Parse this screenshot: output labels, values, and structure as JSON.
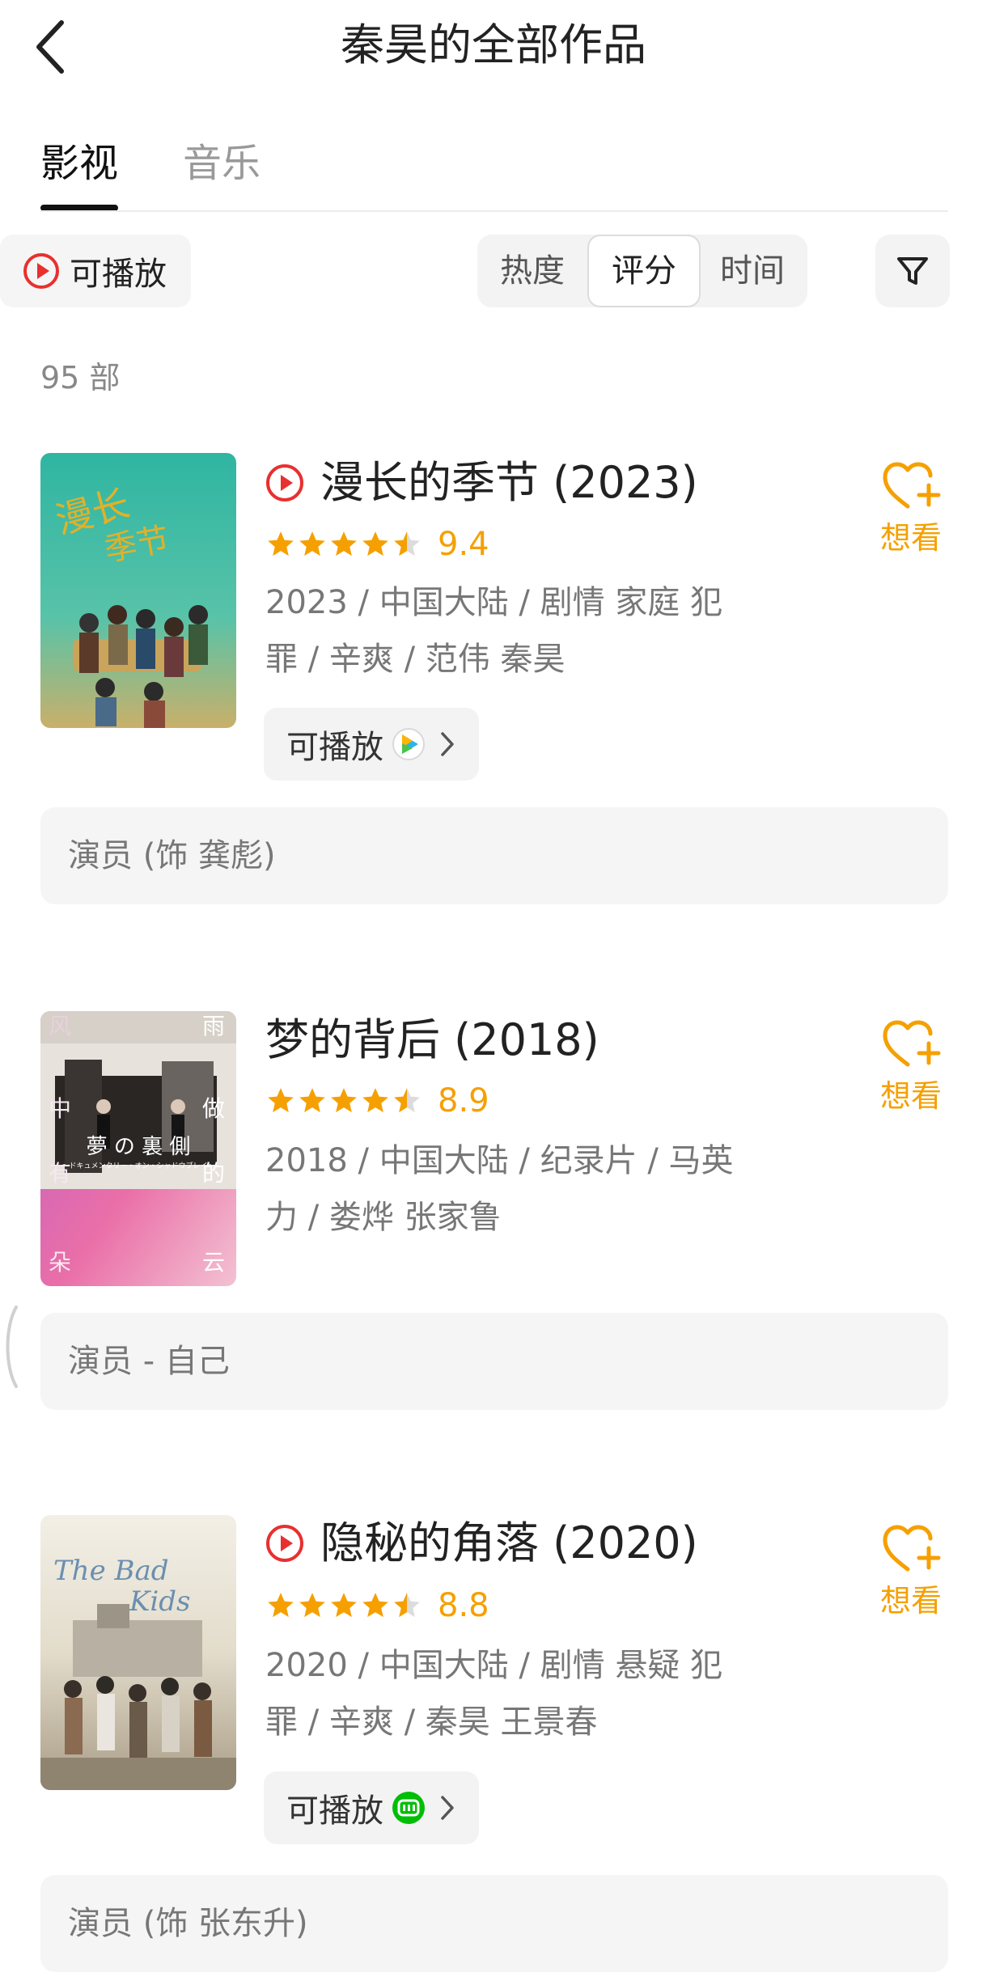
{
  "header": {
    "title": "秦昊的全部作品"
  },
  "tabs": [
    {
      "label": "影视",
      "active": true
    },
    {
      "label": "音乐",
      "active": false
    }
  ],
  "filters": {
    "playable_label": "可播放",
    "sort_options": [
      "热度",
      "评分",
      "时间"
    ],
    "selected_sort": "评分"
  },
  "count_label": "95 部",
  "colors": {
    "accent": "#f5a000",
    "play_red": "#e8302f"
  },
  "items": [
    {
      "title": "漫长的季节 (2023)",
      "playable": true,
      "rating": 9.4,
      "rating_text": "9.4",
      "stars": 4.5,
      "meta_line1": "2023 / 中国大陆 / 剧情 家庭 犯",
      "meta_line2": "罪 / 辛爽 / 范伟 秦昊",
      "source_label": "可播放",
      "source_logo": "tencent-video-icon",
      "want_label": "想看",
      "role": "演员 (饰 龚彪)"
    },
    {
      "title": "梦的背后 (2018)",
      "playable": false,
      "rating": 8.9,
      "rating_text": "8.9",
      "stars": 4.5,
      "meta_line1": "2018 / 中国大陆 / 纪录片 / 马英",
      "meta_line2": "力 / 娄烨 张家鲁",
      "want_label": "想看",
      "role": "演员 - 自己",
      "poster_text": {
        "center": "夢 の 裏 側",
        "left_col": [
          "风",
          "中",
          "有",
          "朵"
        ],
        "right_col": [
          "雨",
          "做",
          "的",
          "云"
        ],
        "subtitle": "～ドキュメンタリー・オン・シャドウプレイ～"
      }
    },
    {
      "title": "隐秘的角落 (2020)",
      "playable": true,
      "rating": 8.8,
      "rating_text": "8.8",
      "stars": 4.5,
      "meta_line1": "2020 / 中国大陆 / 剧情 悬疑 犯",
      "meta_line2": "罪 / 辛爽 / 秦昊 王景春",
      "source_label": "可播放",
      "source_logo": "iqiyi-icon",
      "want_label": "想看",
      "role": "演员 (饰 张东升)"
    }
  ]
}
